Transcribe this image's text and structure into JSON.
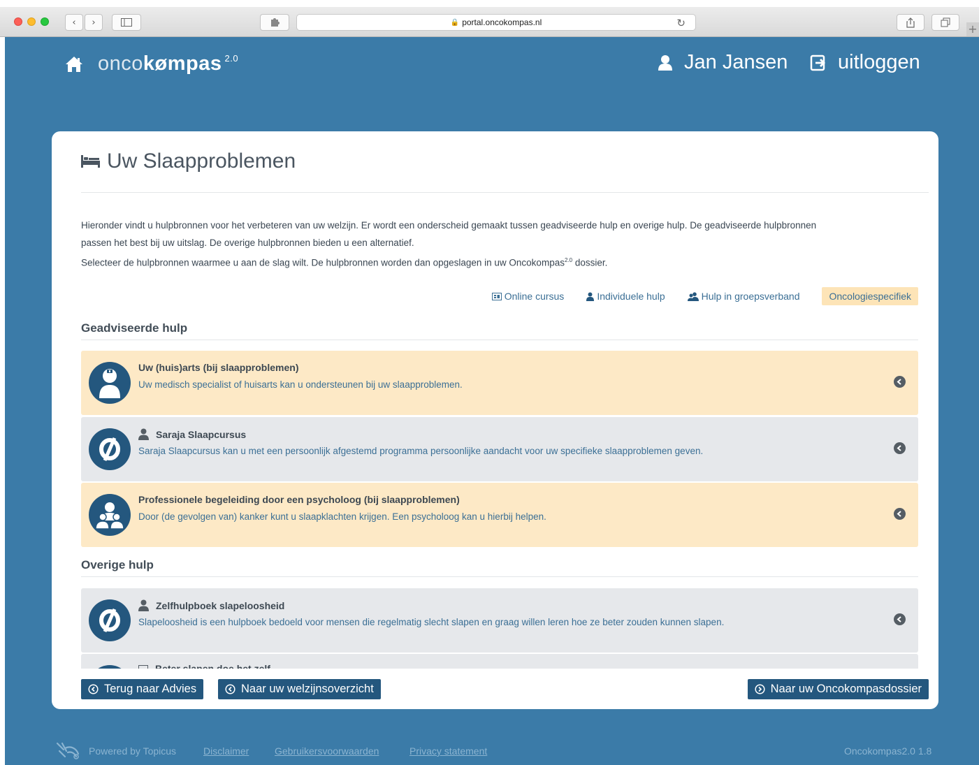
{
  "browser": {
    "url": "portal.oncokompas.nl"
  },
  "header": {
    "logo_light": "onco",
    "logo_bold": "kømpas",
    "logo_version": "2.0",
    "user_name": "Jan Jansen",
    "logout_label": "uitloggen"
  },
  "page": {
    "title": "Uw Slaapproblemen",
    "intro_line1": "Hieronder vindt u hulpbronnen voor het verbeteren van uw welzijn. Er wordt een onderscheid gemaakt tussen geadviseerde hulp en overige hulp. De geadviseerde hulpbronnen",
    "intro_line2": "passen het best bij uw uitslag. De overige hulpbronnen bieden u een alternatief.",
    "intro_line3_pre": "Selecteer de hulpbronnen waarmee u aan de slag wilt. De hulpbronnen worden dan opgeslagen in uw Oncokompas",
    "intro_line3_sup": "2.0",
    "intro_line3_post": " dossier."
  },
  "legend": {
    "online": "Online cursus",
    "individual": "Individuele hulp",
    "group": "Hulp in groepsverband",
    "oncology": "Oncologiespecifiek"
  },
  "sections": {
    "advised": "Geadviseerde hulp",
    "other": "Overige hulp"
  },
  "advised_items": [
    {
      "title": "Uw (huis)arts (bij slaapproblemen)",
      "desc": "Uw medisch specialist of huisarts kan u ondersteunen bij uw slaapproblemen."
    },
    {
      "title": "Saraja Slaapcursus",
      "desc": "Saraja Slaapcursus kan u met een persoonlijk afgestemd programma persoonlijke aandacht voor uw specifieke slaapproblemen geven."
    },
    {
      "title": "Professionele begeleiding door een psycholoog (bij slaapproblemen)",
      "desc": "Door (de gevolgen van) kanker kunt u slaapklachten krijgen. Een psycholoog kan u hierbij helpen."
    }
  ],
  "other_items": [
    {
      "title": "Zelfhulpboek slapeloosheid",
      "desc": "Slapeloosheid is een hulpboek bedoeld voor mensen die regelmatig slecht slapen en graag willen leren hoe ze beter zouden kunnen slapen."
    },
    {
      "title": "Beter slapen doe het zelf",
      "desc": ""
    }
  ],
  "buttons": {
    "back": "Terug naar Advies",
    "overview": "Naar uw welzijnsoverzicht",
    "dossier": "Naar uw Oncokompasdossier"
  },
  "footer": {
    "powered": "Powered by Topicus",
    "disclaimer": "Disclaimer",
    "terms": "Gebruikersvoorwaarden",
    "privacy": "Privacy statement",
    "version": "Oncokompas2.0 1.8"
  },
  "colors": {
    "brand_blue": "#3b7ba8",
    "dark_blue": "#24577e",
    "oncology_highlight": "#fde9c6",
    "other_row": "#e6e8eb"
  }
}
